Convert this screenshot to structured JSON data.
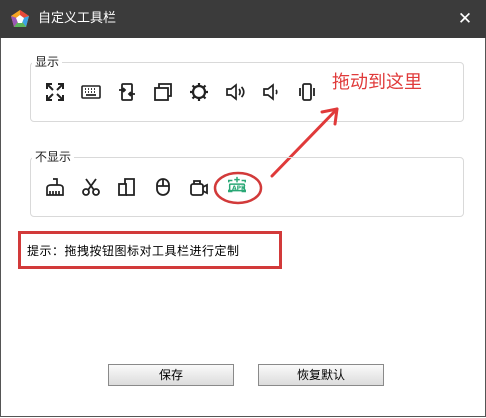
{
  "window": {
    "title": "自定义工具栏",
    "close_glyph": "✕"
  },
  "groups": {
    "show": {
      "label": "显示",
      "icons": [
        "fullscreen-icon",
        "keyboard-icon",
        "rotate-icon",
        "window-icon",
        "settings-icon",
        "volume-up-icon",
        "volume-down-icon",
        "vibrate-icon"
      ]
    },
    "hide": {
      "label": "不显示",
      "icons": [
        "clean-icon",
        "cut-icon",
        "multi-device-icon",
        "mouse-icon",
        "camera-icon",
        "apk-install-icon"
      ]
    }
  },
  "annotation": {
    "callout": "拖动到这里",
    "color": "#e03a3a"
  },
  "apk_badge": "APK",
  "hint": {
    "text": "提示：拖拽按钮图标对工具栏进行定制"
  },
  "buttons": {
    "save": "保存",
    "restore": "恢复默认"
  },
  "colors": {
    "titlebar": "#3b3b3b",
    "apk_icon": "#2aa876",
    "annotation": "#d23a3a"
  }
}
